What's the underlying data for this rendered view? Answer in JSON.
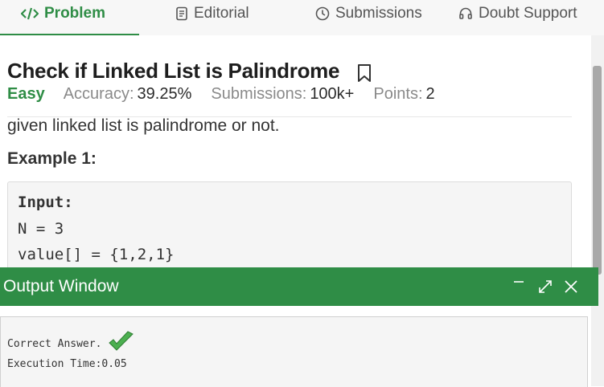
{
  "tabs": {
    "problem": "Problem",
    "editorial": "Editorial",
    "submissions": "Submissions",
    "doubt_support": "Doubt Support"
  },
  "problem": {
    "title": "Check if Linked List is Palindrome",
    "difficulty": "Easy",
    "accuracy_label": "Accuracy:",
    "accuracy_value": "39.25%",
    "submissions_label": "Submissions:",
    "submissions_value": "100k+",
    "points_label": "Points:",
    "points_value": "2",
    "description_tail": "given linked list is palindrome or not.",
    "example_heading": "Example 1:",
    "example": {
      "input_label": "Input:",
      "line_n": "N = 3",
      "line_value": "value[] = {1,2,1}"
    }
  },
  "output_window": {
    "title": "Output Window",
    "result": "Correct Answer.",
    "execution_time": "Execution Time:0.05"
  },
  "colors": {
    "accent": "#2f8d46",
    "check": "#4caf50"
  }
}
